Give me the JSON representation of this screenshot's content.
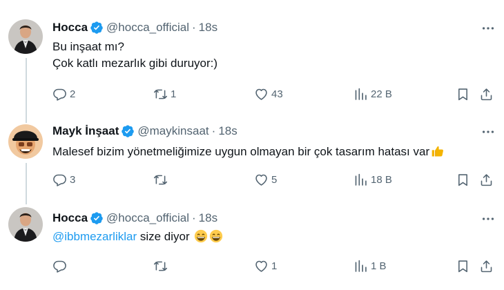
{
  "tweets": [
    {
      "name": "Hocca",
      "handle": "@hocca_official",
      "separator": "·",
      "time": "18s",
      "lines": [
        "Bu inşaat mı?",
        "Çok katlı mezarlık gibi duruyor:)"
      ],
      "replies": "2",
      "retweets": "1",
      "likes": "43",
      "views": "22 B"
    },
    {
      "name": "Mayk İnşaat",
      "handle": "@maykinsaat",
      "separator": "·",
      "time": "18s",
      "text": "Malesef bizim yönetmeliğimize uygun olmayan bir çok tasarım hatası var",
      "emoji": "thumbs-up",
      "replies": "3",
      "retweets": "",
      "likes": "5",
      "views": "18 B"
    },
    {
      "name": "Hocca",
      "handle": "@hocca_official",
      "separator": "·",
      "time": "18s",
      "mention": "@ibbmezarliklar",
      "text": " size diyor",
      "emoji": "grinning-face",
      "replies": "",
      "retweets": "",
      "likes": "1",
      "views": "1 B"
    }
  ],
  "colors": {
    "accent": "#1d9bf0",
    "text": "#0f1419",
    "secondary": "#536471",
    "thread_line": "#cfd9de"
  }
}
